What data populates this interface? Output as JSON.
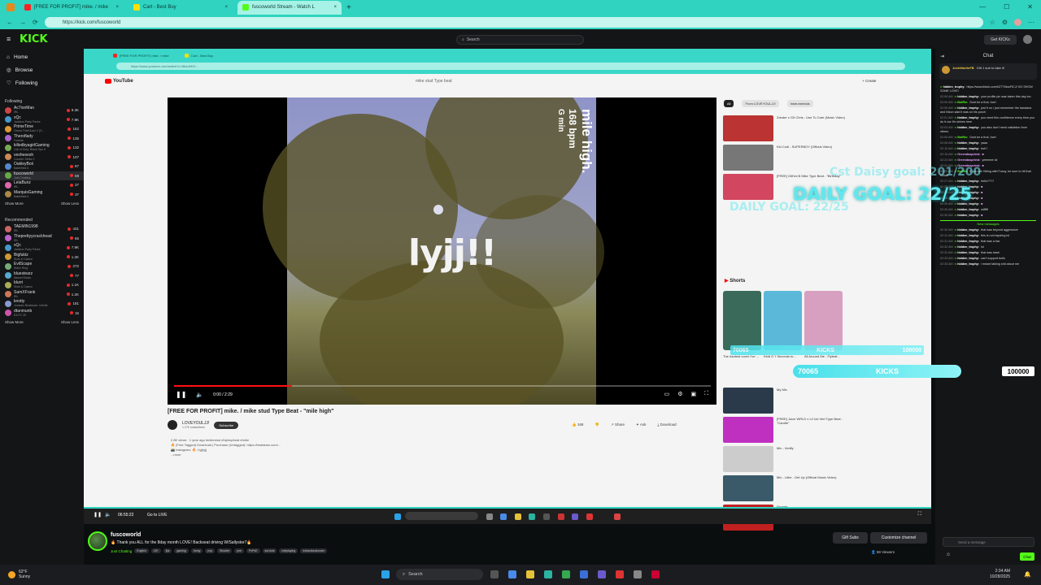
{
  "browser": {
    "tabs": [
      {
        "label": "[FREE FOR PROFIT] mike. / mike",
        "color": "#ff2020"
      },
      {
        "label": "Cart - Best Buy",
        "color": "#ffe000"
      },
      {
        "label": "fuscoworld Stream - Watch L",
        "color": "#53fc18"
      }
    ],
    "url": "https://kick.com/fuscoworld"
  },
  "kick": {
    "logo": "KICK",
    "search_placeholder": "Search",
    "get_kicks": "Get KICKs",
    "nav": [
      "Home",
      "Browse",
      "Following"
    ],
    "following_header": "Following",
    "following": [
      {
        "name": "Ac7ionMan",
        "game": "IRL",
        "count": "9.3K",
        "color": "#c44"
      },
      {
        "name": "xQc",
        "game": "Jackbox Party Packs",
        "count": "7.9K",
        "color": "#49c"
      },
      {
        "name": "PrimeTime",
        "game": "Grand Theft Auto V (G...",
        "count": "162",
        "color": "#d93"
      },
      {
        "name": "Theroflady",
        "game": "Fortnite",
        "count": "135",
        "color": "#a6c"
      },
      {
        "name": "killedbyagirlGaming",
        "game": "Call of Duty: Black Ops 6",
        "count": "132",
        "color": "#7a5"
      },
      {
        "name": "vexheeesh",
        "game": "Counter-Strike 2",
        "count": "107",
        "color": "#c85"
      },
      {
        "name": "OakleyBoii",
        "game": "Battlefield 6",
        "count": "97",
        "color": "#58c"
      },
      {
        "name": "fuscoworld",
        "game": "Just Chatting",
        "count": "59",
        "color": "#6a4",
        "selected": true
      },
      {
        "name": "LeiaBunz",
        "game": "IRL",
        "count": "37",
        "color": "#d6a"
      },
      {
        "name": "MarquisGaming",
        "game": "Battlefield 6",
        "count": "37",
        "color": "#a84"
      }
    ],
    "show_more": "Show More",
    "show_less": "Show Less",
    "recommended_header": "Recommended",
    "recommended": [
      {
        "name": "TAEMIN1998",
        "game": "IRL",
        "count": "431",
        "color": "#c66"
      },
      {
        "name": "Theprettyycrackhead",
        "game": "IRL",
        "count": "65",
        "color": "#b6c"
      },
      {
        "name": "xQc",
        "game": "Jackbox Party Packs",
        "count": "7.9K",
        "color": "#49c"
      },
      {
        "name": "Bigfuktz",
        "game": "Slots & Casino",
        "count": "1.2K",
        "color": "#c93"
      },
      {
        "name": "EvilScape",
        "game": "Elden Ring",
        "count": "272",
        "color": "#7a7"
      },
      {
        "name": "bluestearz",
        "game": "Marvel Rivals",
        "count": "77",
        "color": "#5ac"
      },
      {
        "name": "blurri",
        "game": "Slots & Casino",
        "count": "1.1K",
        "color": "#aa5"
      },
      {
        "name": "SamXFrank",
        "game": "IRL",
        "count": "1.2K",
        "color": "#c75"
      },
      {
        "name": "knotty",
        "game": "Jurassic Beatdown: Infinite",
        "count": "181",
        "color": "#89c"
      },
      {
        "name": "dtanmunb",
        "game": "EA FC 25",
        "count": "15",
        "color": "#c5a"
      }
    ]
  },
  "stream_browser": {
    "tabs": [
      "[FREE FOR PROFIT] mike. / mike",
      "Cart - Best Buy"
    ],
    "url": "https://www.youtube.com/watch?v=8kmJMCt...",
    "yt_logo": "YouTube",
    "yt_query": "mike stud Type beat",
    "create": "+ Create",
    "video_center_text": "lyjj!!",
    "video_side_title": "mile high.",
    "video_side_bpm": "168 bpm",
    "video_side_key": "G min",
    "time": "0:00 / 2:29",
    "title": "[FREE FOR PROFIT] mike. / mike stud Type Beat - \"mile high\"",
    "channel": "LOVEYOULJJ!",
    "subscribers": "1.27K subscribers",
    "subscribe": "Subscribe",
    "likes": "168",
    "share": "Share",
    "ask": "Ask",
    "download": "Download",
    "desc_lines": [
      "2.8K views · 1 year ago #mikestud #hiphopbeat #mike",
      "🔥 (Free Tagged) Download | Purchase (Untagged): https://beatstars.com/...",
      "📸 Instagram: 🔥 / lyjjtyjj",
      "...more"
    ],
    "chips": [
      "All",
      "From LOVEYOULJJ!",
      "Instrumentals"
    ],
    "recs": [
      {
        "title": "Zander x G5 Chris - Use To Care (Music Video)",
        "color": "#b33"
      },
      {
        "title": "Kid Cudi - SUPERBOY (Official Video)",
        "color": "#777"
      },
      {
        "title": "[FREE] Gift'ed B Mike Type Beat - \"Birthday\"",
        "color": "#d2465f"
      }
    ],
    "shorts_header": "Shorts",
    "shorts": [
      {
        "title": "The hardest cover I've ...",
        "color": "#3a6a5a"
      },
      {
        "title": "Kidd G 'I Seconds to...",
        "color": "#5cb8d8"
      },
      {
        "title": "All Around Me - Flyleaf...",
        "color": "#d8a0c0"
      }
    ],
    "recs2": [
      {
        "title": "My Mix",
        "color": "#2a3a4a"
      },
      {
        "title": "[FREE] Juice WRLD x Lil Uzi Vert Type Beat - \"Candle\"",
        "color": "#c030c0"
      },
      {
        "title": "Mix - Vedify",
        "color": "#ccc"
      },
      {
        "title": "Mix - Lithe - Get Up (Official Music Video)",
        "color": "#3a5a6a"
      },
      {
        "title": "Secrets",
        "color": "#c02020"
      }
    ],
    "stream_time": "06:55:22",
    "go_live": "Go to LIVE",
    "overlay_kicks_left": "70065",
    "overlay_kicks_mid": "KICKS",
    "overlay_kicks_right": "100000"
  },
  "overlay": {
    "goal1": "Cst Daisy goal: 201/200",
    "goal2": "DAILY GOAL: 22/25",
    "goal3": "DAILY GOAL: 22/25",
    "kicks_left": "70065",
    "kicks_mid": "KICKS",
    "kicks_max": "100000"
  },
  "chat": {
    "header": "Chat",
    "pinned_user": "JoshMartinFB",
    "pinned_text": "Gift 1 sub to take it!",
    "messages": [
      {
        "time": "",
        "user": "hidden_trophy:",
        "text": "https://www.tiktok.com/t/ZT7Mcz/RCJ/ GO SHOW SOME LOVE!",
        "cls": ""
      },
      {
        "time": "02:00 AM",
        "user": "hidden_trophy:",
        "text": "your profile pic was taken this day too",
        "cls": ""
      },
      {
        "time": "02:00 AM",
        "user": "BotRic:",
        "text": "Dont be a thot, hoe!",
        "cls": "g"
      },
      {
        "time": "02:00 AM",
        "user": "hidden_trophy:",
        "text": "just fr no i just remember the bandana and Nixon said it was on his porch",
        "cls": ""
      },
      {
        "time": "02:01 AM",
        "user": "hidden_trophy:",
        "text": "you need this confidence every time you do it cuz it's shines here",
        "cls": ""
      },
      {
        "time": "02:03 AM",
        "user": "hidden_trophy:",
        "text": "you also don't need validation from others",
        "cls": ""
      },
      {
        "time": "02:05 AM",
        "user": "BotRic:",
        "text": "Dont be a thot, hoe!",
        "cls": "g"
      },
      {
        "time": "02:08 AM",
        "user": "hidden_trophy:",
        "text": "yaaa",
        "cls": ""
      },
      {
        "time": "02:10 AM",
        "user": "hidden_trophy:",
        "text": "huh?",
        "cls": ""
      },
      {
        "time": "02:15 AM",
        "user": "Greendaspriest:",
        "text": "",
        "cls": "p"
      },
      {
        "time": "02:23 AM",
        "user": "Greendaspriest:",
        "text": "yeeeeee lol",
        "cls": "p"
      },
      {
        "time": "02:24 AM",
        "user": "Greendaspriest:",
        "text": "",
        "cls": "p"
      },
      {
        "time": "02:25 AM",
        "user": "BotRic:",
        "text": "If you are Vibing with Fuscy, be sure to hit that follow!",
        "cls": "g"
      },
      {
        "time": "02:27 AM",
        "user": "hidden_trophy:",
        "text": "hello????",
        "cls": ""
      },
      {
        "time": "02:28 AM",
        "user": "hidden_trophy:",
        "text": "",
        "cls": ""
      },
      {
        "time": "02:28 AM",
        "user": "hidden_trophy:",
        "text": "",
        "cls": ""
      },
      {
        "time": "02:29 AM",
        "user": "hidden_trophy:",
        "text": "",
        "cls": ""
      },
      {
        "time": "02:29 AM",
        "user": "hidden_trophy:",
        "text": "",
        "cls": ""
      },
      {
        "time": "02:30 AM",
        "user": "hidden_trophy:",
        "text": "wtfffff",
        "cls": ""
      },
      {
        "time": "02:30 AM",
        "user": "hidden_trophy:",
        "text": "",
        "cls": ""
      }
    ],
    "new_messages": "New messages",
    "messages2": [
      {
        "time": "02:30 AM",
        "user": "hidden_trophy:",
        "text": "that was beyond aggressive",
        "cls": ""
      },
      {
        "time": "02:31 AM",
        "user": "hidden_trophy:",
        "text": "this is not inspiring lol",
        "cls": ""
      },
      {
        "time": "02:31 AM",
        "user": "hidden_trophy:",
        "text": "that was a bar",
        "cls": ""
      },
      {
        "time": "02:32 AM",
        "user": "hidden_trophy:",
        "text": "lol",
        "cls": ""
      },
      {
        "time": "02:32 AM",
        "user": "hidden_trophy:",
        "text": "that was trash",
        "cls": ""
      },
      {
        "time": "02:33 AM",
        "user": "hidden_trophy:",
        "text": "can't support bulls",
        "cls": ""
      },
      {
        "time": "02:33 AM",
        "user": "hidden_trophy:",
        "text": "i meant talking shit about me",
        "cls": ""
      }
    ],
    "send_placeholder": "Send a message",
    "chat_button": "Chat"
  },
  "info": {
    "name": "fuscoworld",
    "title": "🔥 Thank you ALL for the 8day month LOVE! Backseat driving W/Sallyster7🔥",
    "category": "Just Chatting",
    "tags": [
      "English",
      "18+",
      "fps",
      "gaming",
      "funny",
      "pvp",
      "Shooter",
      "pve",
      "PvPvE",
      "survival",
      "roleplaying",
      "extractionshooter"
    ],
    "gift_subs": "Gift Subs",
    "customize": "Customize channel",
    "viewers": "59 Viewers"
  },
  "windows": {
    "temp": "62°F",
    "weather": "Sunny",
    "search": "Search",
    "time": "2:34 AM",
    "date": "10/28/2025"
  }
}
